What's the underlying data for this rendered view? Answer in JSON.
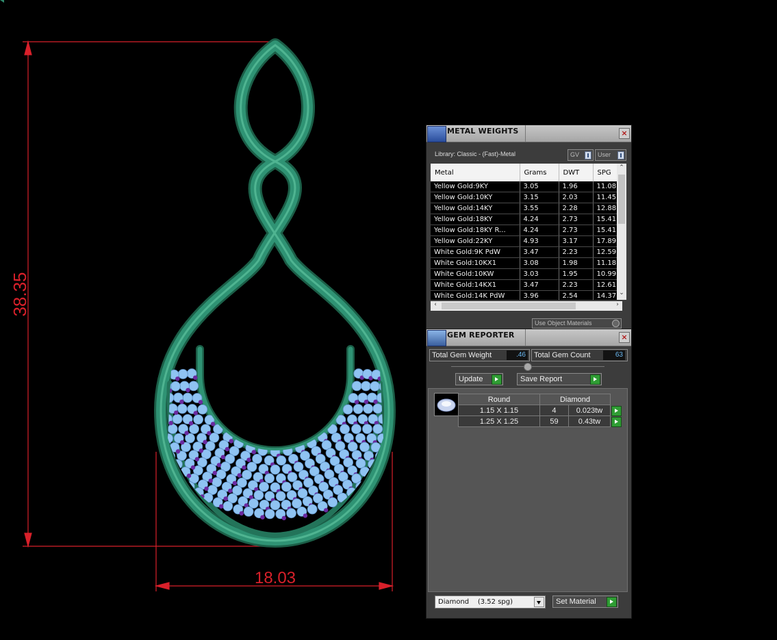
{
  "viewport": {
    "height_dimension": "38.35",
    "width_dimension": "18.03",
    "colors": {
      "metal": "#2e8a6c",
      "gem_blue": "#8fc3f2",
      "gem_purple": "#6a2aa0",
      "dimension": "#d8202a"
    }
  },
  "metal_weights": {
    "title": "METAL WEIGHTS",
    "library": "Library: Classic - (Fast)-Metal",
    "gv_label": "GV",
    "user_label": "User",
    "columns": [
      "Metal",
      "Grams",
      "DWT",
      "SPG"
    ],
    "rows": [
      [
        "Yellow Gold:9KY",
        "3.05",
        "1.96",
        "11.08"
      ],
      [
        "Yellow Gold:10KY",
        "3.15",
        "2.03",
        "11.45"
      ],
      [
        "Yellow Gold:14KY",
        "3.55",
        "2.28",
        "12.88"
      ],
      [
        "Yellow Gold:18KY",
        "4.24",
        "2.73",
        "15.41"
      ],
      [
        "Yellow Gold:18KY R...",
        "4.24",
        "2.73",
        "15.41"
      ],
      [
        "Yellow Gold:22KY",
        "4.93",
        "3.17",
        "17.89"
      ],
      [
        "White Gold:9K PdW",
        "3.47",
        "2.23",
        "12.59"
      ],
      [
        "White Gold:10KX1",
        "3.08",
        "1.98",
        "11.18"
      ],
      [
        "White Gold:10KW",
        "3.03",
        "1.95",
        "10.99"
      ],
      [
        "White Gold:14KX1",
        "3.47",
        "2.23",
        "12.61"
      ],
      [
        "White Gold:14K PdW",
        "3.96",
        "2.54",
        "14.37"
      ]
    ],
    "use_object_materials": "Use Object Materials"
  },
  "gem_reporter": {
    "title": "GEM REPORTER",
    "total_gem_weight_label": "Total Gem Weight",
    "total_gem_weight": ".46",
    "total_gem_count_label": "Total Gem Count",
    "total_gem_count": "63",
    "update_label": "Update",
    "save_report_label": "Save Report",
    "shape_header": "Round",
    "material_header": "Diamond",
    "gems": [
      {
        "size": "1.15 X 1.15",
        "count": "4",
        "weight": "0.023tw"
      },
      {
        "size": "1.25 X 1.25",
        "count": "59",
        "weight": "0.43tw"
      }
    ],
    "material_select": "Diamond    (3.52 spg)",
    "set_material_label": "Set Material"
  }
}
